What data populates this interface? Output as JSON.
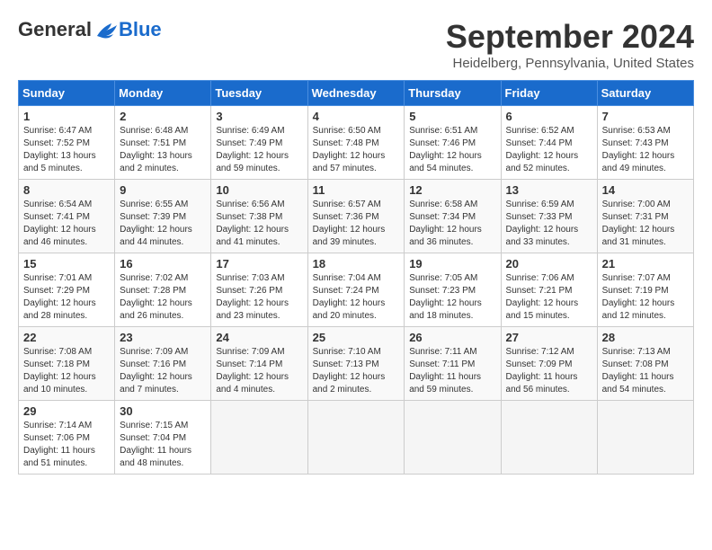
{
  "logo": {
    "general": "General",
    "blue": "Blue"
  },
  "title": {
    "month": "September 2024",
    "location": "Heidelberg, Pennsylvania, United States"
  },
  "headers": [
    "Sunday",
    "Monday",
    "Tuesday",
    "Wednesday",
    "Thursday",
    "Friday",
    "Saturday"
  ],
  "weeks": [
    [
      {
        "day": "1",
        "info": "Sunrise: 6:47 AM\nSunset: 7:52 PM\nDaylight: 13 hours\nand 5 minutes."
      },
      {
        "day": "2",
        "info": "Sunrise: 6:48 AM\nSunset: 7:51 PM\nDaylight: 13 hours\nand 2 minutes."
      },
      {
        "day": "3",
        "info": "Sunrise: 6:49 AM\nSunset: 7:49 PM\nDaylight: 12 hours\nand 59 minutes."
      },
      {
        "day": "4",
        "info": "Sunrise: 6:50 AM\nSunset: 7:48 PM\nDaylight: 12 hours\nand 57 minutes."
      },
      {
        "day": "5",
        "info": "Sunrise: 6:51 AM\nSunset: 7:46 PM\nDaylight: 12 hours\nand 54 minutes."
      },
      {
        "day": "6",
        "info": "Sunrise: 6:52 AM\nSunset: 7:44 PM\nDaylight: 12 hours\nand 52 minutes."
      },
      {
        "day": "7",
        "info": "Sunrise: 6:53 AM\nSunset: 7:43 PM\nDaylight: 12 hours\nand 49 minutes."
      }
    ],
    [
      {
        "day": "8",
        "info": "Sunrise: 6:54 AM\nSunset: 7:41 PM\nDaylight: 12 hours\nand 46 minutes."
      },
      {
        "day": "9",
        "info": "Sunrise: 6:55 AM\nSunset: 7:39 PM\nDaylight: 12 hours\nand 44 minutes."
      },
      {
        "day": "10",
        "info": "Sunrise: 6:56 AM\nSunset: 7:38 PM\nDaylight: 12 hours\nand 41 minutes."
      },
      {
        "day": "11",
        "info": "Sunrise: 6:57 AM\nSunset: 7:36 PM\nDaylight: 12 hours\nand 39 minutes."
      },
      {
        "day": "12",
        "info": "Sunrise: 6:58 AM\nSunset: 7:34 PM\nDaylight: 12 hours\nand 36 minutes."
      },
      {
        "day": "13",
        "info": "Sunrise: 6:59 AM\nSunset: 7:33 PM\nDaylight: 12 hours\nand 33 minutes."
      },
      {
        "day": "14",
        "info": "Sunrise: 7:00 AM\nSunset: 7:31 PM\nDaylight: 12 hours\nand 31 minutes."
      }
    ],
    [
      {
        "day": "15",
        "info": "Sunrise: 7:01 AM\nSunset: 7:29 PM\nDaylight: 12 hours\nand 28 minutes."
      },
      {
        "day": "16",
        "info": "Sunrise: 7:02 AM\nSunset: 7:28 PM\nDaylight: 12 hours\nand 26 minutes."
      },
      {
        "day": "17",
        "info": "Sunrise: 7:03 AM\nSunset: 7:26 PM\nDaylight: 12 hours\nand 23 minutes."
      },
      {
        "day": "18",
        "info": "Sunrise: 7:04 AM\nSunset: 7:24 PM\nDaylight: 12 hours\nand 20 minutes."
      },
      {
        "day": "19",
        "info": "Sunrise: 7:05 AM\nSunset: 7:23 PM\nDaylight: 12 hours\nand 18 minutes."
      },
      {
        "day": "20",
        "info": "Sunrise: 7:06 AM\nSunset: 7:21 PM\nDaylight: 12 hours\nand 15 minutes."
      },
      {
        "day": "21",
        "info": "Sunrise: 7:07 AM\nSunset: 7:19 PM\nDaylight: 12 hours\nand 12 minutes."
      }
    ],
    [
      {
        "day": "22",
        "info": "Sunrise: 7:08 AM\nSunset: 7:18 PM\nDaylight: 12 hours\nand 10 minutes."
      },
      {
        "day": "23",
        "info": "Sunrise: 7:09 AM\nSunset: 7:16 PM\nDaylight: 12 hours\nand 7 minutes."
      },
      {
        "day": "24",
        "info": "Sunrise: 7:09 AM\nSunset: 7:14 PM\nDaylight: 12 hours\nand 4 minutes."
      },
      {
        "day": "25",
        "info": "Sunrise: 7:10 AM\nSunset: 7:13 PM\nDaylight: 12 hours\nand 2 minutes."
      },
      {
        "day": "26",
        "info": "Sunrise: 7:11 AM\nSunset: 7:11 PM\nDaylight: 11 hours\nand 59 minutes."
      },
      {
        "day": "27",
        "info": "Sunrise: 7:12 AM\nSunset: 7:09 PM\nDaylight: 11 hours\nand 56 minutes."
      },
      {
        "day": "28",
        "info": "Sunrise: 7:13 AM\nSunset: 7:08 PM\nDaylight: 11 hours\nand 54 minutes."
      }
    ],
    [
      {
        "day": "29",
        "info": "Sunrise: 7:14 AM\nSunset: 7:06 PM\nDaylight: 11 hours\nand 51 minutes."
      },
      {
        "day": "30",
        "info": "Sunrise: 7:15 AM\nSunset: 7:04 PM\nDaylight: 11 hours\nand 48 minutes."
      },
      {
        "day": "",
        "info": ""
      },
      {
        "day": "",
        "info": ""
      },
      {
        "day": "",
        "info": ""
      },
      {
        "day": "",
        "info": ""
      },
      {
        "day": "",
        "info": ""
      }
    ]
  ]
}
